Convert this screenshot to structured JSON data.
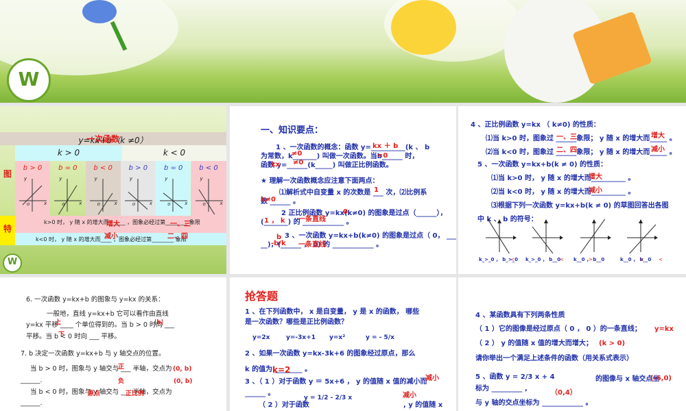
{
  "slide1": {
    "title": "y=kx+b（k ≠0）",
    "title_overlay": "一次函数",
    "k_pos": "k > 0",
    "k_neg": "k < 0",
    "row_label_graph": "图",
    "row_label_feature": "特",
    "b_labels": [
      "b > 0",
      "b = 0",
      "b < 0",
      "b > 0",
      "b = 0",
      "b < 0"
    ],
    "feature_pos": "k>0 时， y 随 x 的增大而______ ，图象必经过第________ 象限",
    "feature_neg": "k<0 时， y 随 x 的增大而____ ，图象必经过第________ 象限",
    "ans_pos_1": "增大",
    "ans_pos_2": "一、三",
    "ans_neg_1": "减小",
    "ans_neg_2": "二、四",
    "axis_y": "y",
    "axis_x": "x",
    "origin": "o"
  },
  "slide2": {
    "heading": "一、知识要点：",
    "lines": [
      "1 、一次函数的概念：函数 y=__________(k 、 b",
      "为常数，k_______) 叫做一次函数。当b______ 时，",
      "函数 y=______(k_____) 叫做正比例函数。",
      "★ 理解一次函数概念应注意下面两点：",
      "⑴解析式中自变量 x 的次数是 ___ 次，⑵比例系",
      "数 ______ 。",
      "2 正比例函数 y=kx(k≠0) 的图象是过点（______），",
      "(_______) 的 ____________ 。",
      "3 、一次函数 y=kx+b(k≠0) 的图象是过点（ 0， ___",
      "__)，(______ ， 0) 的 ____________ 。"
    ],
    "answers": [
      "kx ＋ b",
      "≠0",
      "=0",
      "kx",
      "≠0",
      "1",
      "k≠0",
      "0",
      "1 ， k",
      "一条直线",
      "b",
      "-b/k",
      "一条直线"
    ]
  },
  "slide3": {
    "lines": [
      "4 、正比例函数 y=kx （ k≠0) 的性质：",
      "⑴当 k>0 时，图象过 ______象限； y 随 x 的增大而_____ 。",
      "⑵当 k<0 时，图象过 ______象限； y 随 x 的增大而_____ 。",
      "5 、一次函数 y=kx+b(k ≠ 0) 的性质：",
      "⑴当 k>0 时， y 随 x 的增大而__________ 。",
      "⑵当 k<0 时， y 随 x 的增大而__________ 。",
      "⑶根据下列一次函数 y=kx+b(k ≠ 0) 的草图回答出各图",
      "中 k 、 b 的符号："
    ],
    "answers": [
      "一、三",
      "增大",
      "二、四",
      "减小",
      "增大",
      "减小"
    ],
    "graph_labels": [
      "k_>_0 ， b_>_0",
      "k_>_0 ， b__0",
      "k__0 ， b__0",
      "k__0 ， b__0"
    ],
    "graph_answers": [
      "<",
      "<",
      ">",
      "<",
      "<"
    ]
  },
  "slide4": {
    "lines": [
      "6. 一次函数 y=kx+b 的图象与 y=kx 的关系：",
      "一般地，直线 y=kx+b 它可以看作由直线",
      "y=kx 平移 ____ 个单位得到的。当 b > 0 时向 ___",
      "平移。当 b < 0 时向 ___ 平移。",
      "7. b 决定一次函数 y=kx+b 与 y 轴交点的位置。",
      "当 b > 0 时，图象与 y 轴交与 ___ 半轴，交点为",
      "______.",
      "当 b < 0 时，图象与 y 轴交与 ___ 半轴，交点为",
      "______."
    ],
    "answers": [
      "|b|",
      "上",
      "下",
      "正",
      "(0, b)",
      "负",
      "(0, b)",
      "原点",
      "正比例"
    ]
  },
  "slide5": {
    "heading": "抢答题",
    "lines": [
      "1 、在下列函数中，  x 是自变量，  y 是 x 的函数， 哪些",
      "是一次函数？哪些是正比例函数？",
      "2 、如果一次函数 y=kx-3k+6 的图象经过原点，那么",
      "k 的值为 ________ 。",
      "3 、（ 1 ）对于函数 y ＝ 5x+6 ， y 的值随 x 值的减小而",
      "______ 。",
      "（ 2 ）对于函数",
      ", y 的值随 x"
    ],
    "functions": [
      "y=2x",
      "y=-3x+1",
      "y=x²",
      "y = - 5/x",
      "y = 1/2 - 2/3 x"
    ],
    "answers": [
      "k=2",
      "减小",
      "减小"
    ]
  },
  "slide6": {
    "lines": [
      "4 、某函数具有下列两条性质",
      "（ 1 ）它的图像是经过原点（ 0 ， 0 ）的一条直线；",
      "（ 2 ） y 的值随 x 值的增大而增大；",
      "请你举出一个满足上述条件的函数（用关系式表示）",
      "5 、函数  y = 2/3 x + 4",
      "的图像与 x 轴交点坐",
      "标为 _________ ,",
      "与 y 轴的交点坐标为 ____________ 。"
    ],
    "answers": [
      "y=kx",
      "(k > 0)",
      "(-6,0)",
      "（0,4）"
    ]
  }
}
